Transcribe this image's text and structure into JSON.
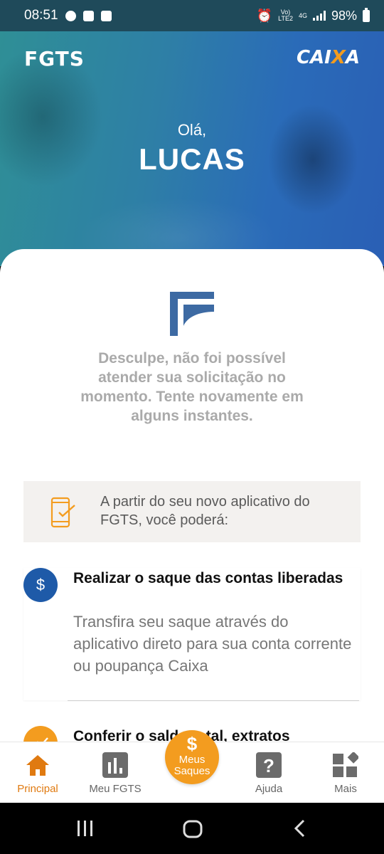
{
  "status_bar": {
    "time": "08:51",
    "signal_top": "Vo)",
    "signal_bottom": "LTE2",
    "network": "4G",
    "battery": "98%"
  },
  "header": {
    "fgts_logo": "FGTS",
    "caixa_logo_pre": "CAI",
    "caixa_logo_x": "X",
    "caixa_logo_post": "A",
    "greeting": "Olá,",
    "user_name": "LUCAS"
  },
  "error_message": "Desculpe, não foi possível atender sua solicitação no momento. Tente novamente em alguns instantes.",
  "info_box": {
    "text": "A partir do seu novo aplicativo do FGTS, você poderá:"
  },
  "features": [
    {
      "icon": "dollar-icon",
      "title": "Realizar o saque das contas liberadas",
      "description": "Transfira seu saque através do aplicativo direto para sua conta corrente ou poupança Caixa"
    },
    {
      "icon": "chart-icon",
      "title": "Conferir o saldo total, extratos"
    }
  ],
  "bottom_nav": {
    "principal": "Principal",
    "meu_fgts": "Meu FGTS",
    "saques_symbol": "$",
    "saques_line1": "Meus",
    "saques_line2": "Saques",
    "ajuda": "Ajuda",
    "mais": "Mais"
  },
  "colors": {
    "brand_blue": "#1e5aa8",
    "accent_orange": "#f39c1f",
    "error_gray": "#aaaaaa"
  }
}
